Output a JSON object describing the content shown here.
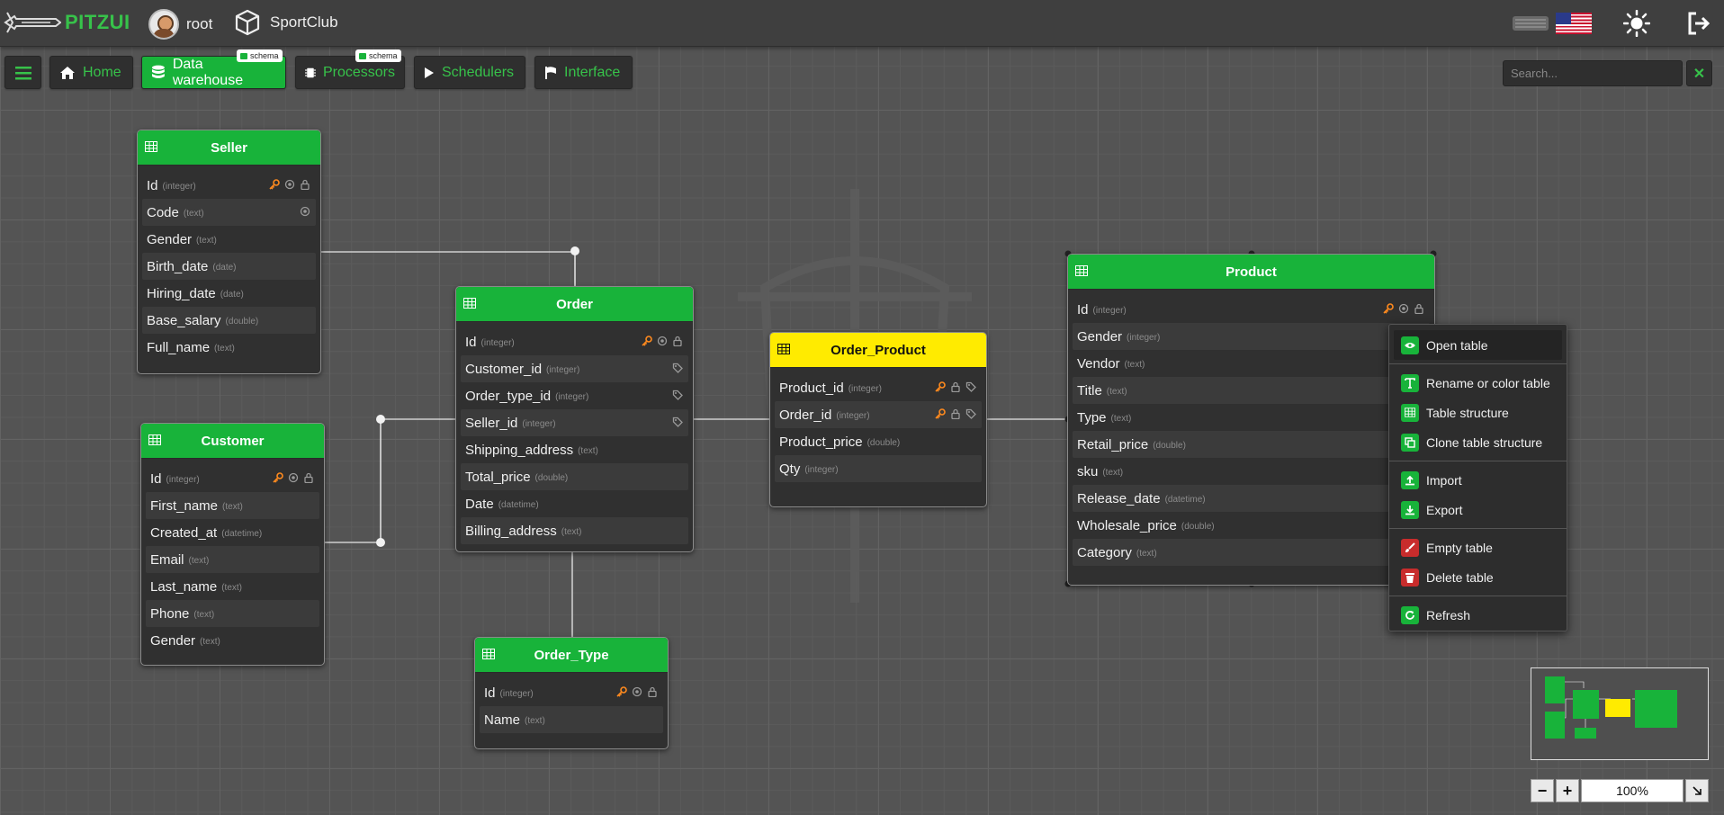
{
  "app": {
    "name": "PITZUI",
    "user": "root",
    "project": "SportClub"
  },
  "nav": {
    "items": [
      {
        "label": "Home",
        "icon": "home-icon"
      },
      {
        "label": "Data warehouse",
        "icon": "database-icon",
        "active": true,
        "badge": "schema"
      },
      {
        "label": "Processors",
        "icon": "chip-icon",
        "badge": "schema"
      },
      {
        "label": "Schedulers",
        "icon": "play-icon"
      },
      {
        "label": "Interface",
        "icon": "flag-icon"
      }
    ],
    "search_placeholder": "Search..."
  },
  "tables": {
    "seller": {
      "name": "Seller",
      "fields": [
        {
          "name": "Id",
          "type": "(integer)"
        },
        {
          "name": "Code",
          "type": "(text)"
        },
        {
          "name": "Gender",
          "type": "(text)"
        },
        {
          "name": "Birth_date",
          "type": "(date)"
        },
        {
          "name": "Hiring_date",
          "type": "(date)"
        },
        {
          "name": "Base_salary",
          "type": "(double)"
        },
        {
          "name": "Full_name",
          "type": "(text)"
        }
      ]
    },
    "customer": {
      "name": "Customer",
      "fields": [
        {
          "name": "Id",
          "type": "(integer)"
        },
        {
          "name": "First_name",
          "type": "(text)"
        },
        {
          "name": "Created_at",
          "type": "(datetime)"
        },
        {
          "name": "Email",
          "type": "(text)"
        },
        {
          "name": "Last_name",
          "type": "(text)"
        },
        {
          "name": "Phone",
          "type": "(text)"
        },
        {
          "name": "Gender",
          "type": "(text)"
        }
      ]
    },
    "order": {
      "name": "Order",
      "fields": [
        {
          "name": "Id",
          "type": "(integer)"
        },
        {
          "name": "Customer_id",
          "type": "(integer)"
        },
        {
          "name": "Order_type_id",
          "type": "(integer)"
        },
        {
          "name": "Seller_id",
          "type": "(integer)"
        },
        {
          "name": "Shipping_address",
          "type": "(text)"
        },
        {
          "name": "Total_price",
          "type": "(double)"
        },
        {
          "name": "Date",
          "type": "(datetime)"
        },
        {
          "name": "Billing_address",
          "type": "(text)"
        }
      ]
    },
    "order_type": {
      "name": "Order_Type",
      "fields": [
        {
          "name": "Id",
          "type": "(integer)"
        },
        {
          "name": "Name",
          "type": "(text)"
        }
      ]
    },
    "order_product": {
      "name": "Order_Product",
      "fields": [
        {
          "name": "Product_id",
          "type": "(integer)"
        },
        {
          "name": "Order_id",
          "type": "(integer)"
        },
        {
          "name": "Product_price",
          "type": "(double)"
        },
        {
          "name": "Qty",
          "type": "(integer)"
        }
      ]
    },
    "product": {
      "name": "Product",
      "fields": [
        {
          "name": "Id",
          "type": "(integer)"
        },
        {
          "name": "Gender",
          "type": "(integer)"
        },
        {
          "name": "Vendor",
          "type": "(text)"
        },
        {
          "name": "Title",
          "type": "(text)"
        },
        {
          "name": "Type",
          "type": "(text)"
        },
        {
          "name": "Retail_price",
          "type": "(double)"
        },
        {
          "name": "sku",
          "type": "(text)"
        },
        {
          "name": "Release_date",
          "type": "(datetime)"
        },
        {
          "name": "Wholesale_price",
          "type": "(double)"
        },
        {
          "name": "Category",
          "type": "(text)"
        }
      ]
    }
  },
  "context_menu": {
    "open": "Open table",
    "rename": "Rename or color table",
    "structure": "Table structure",
    "clone": "Clone table structure",
    "import": "Import",
    "export": "Export",
    "empty": "Empty table",
    "delete": "Delete table",
    "refresh": "Refresh"
  },
  "zoom": {
    "value": "100%"
  },
  "colors": {
    "accent": "#18b33a",
    "highlight": "#ffeb00",
    "key": "#ff8a1e",
    "danger": "#c82c2c"
  }
}
